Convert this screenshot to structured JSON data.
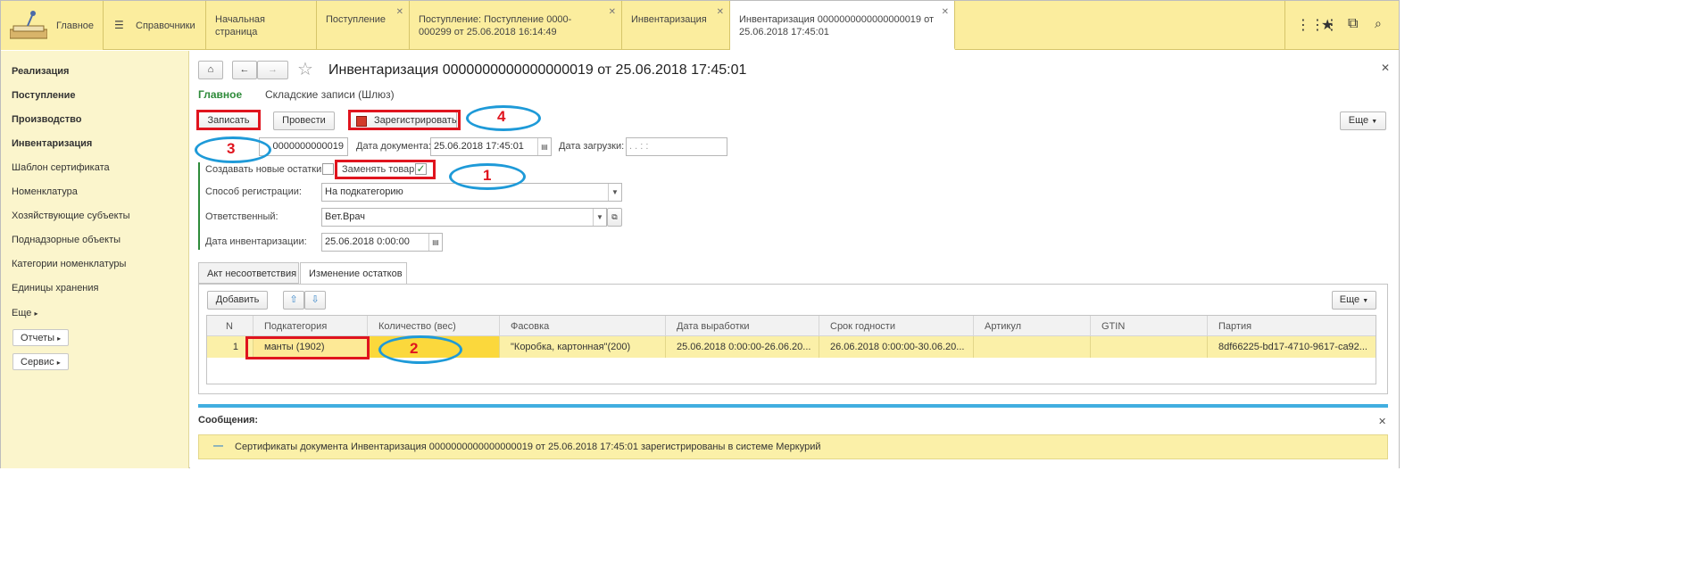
{
  "topbar": {
    "home_label": "Главное",
    "directories_label": "Справочники",
    "tabs": [
      {
        "label": "Начальная страница"
      },
      {
        "label": "Поступление"
      },
      {
        "label": "Поступление: Поступление 0000-000299 от 25.06.2018 16:14:49"
      },
      {
        "label": "Инвентаризация"
      },
      {
        "label": "Инвентаризация 0000000000000000019 от 25.06.2018 17:45:01"
      }
    ],
    "icons": [
      "apps-grid-icon",
      "star-icon",
      "history-icon",
      "search-icon"
    ]
  },
  "sidebar": {
    "items": [
      {
        "label": "Реализация"
      },
      {
        "label": "Поступление"
      },
      {
        "label": "Производство"
      },
      {
        "label": "Инвентаризация"
      },
      {
        "label": "Шаблон сертификата"
      },
      {
        "label": "Номенклатура"
      },
      {
        "label": "Хозяйствующие субъекты"
      },
      {
        "label": "Поднадзорные объекты"
      },
      {
        "label": "Категории номенклатуры"
      },
      {
        "label": "Единицы хранения"
      }
    ],
    "more_label": "Еще",
    "reports_label": "Отчеты",
    "service_label": "Сервис"
  },
  "doc": {
    "title": "Инвентаризация 0000000000000000019 от 25.06.2018 17:45:01",
    "subtabs": [
      "Главное",
      "Складские записи (Шлюз)"
    ],
    "buttons": {
      "save": "Записать",
      "post": "Провести",
      "register": "Зарегистрировать",
      "more": "Еще"
    },
    "number_value": "0000000000019",
    "doc_date_label": "Дата документа:",
    "doc_date_value": "25.06.2018 17:45:01",
    "load_date_label": "Дата загрузки:",
    "load_date_value": " .   .      :  :",
    "create_new_label": "Создавать новые остатки:",
    "replace_goods_label": "Заменять товар:",
    "reg_method_label": "Способ регистрации:",
    "reg_method_value": "На подкатегорию",
    "responsible_label": "Ответственный:",
    "responsible_value": "Вет.Врач",
    "inv_date_label": "Дата инвентаризации:",
    "inv_date_value": "25.06.2018  0:00:00"
  },
  "tabs": {
    "mismatch_label": "Акт несоответствия",
    "changes_label": "Изменение остатков"
  },
  "grid": {
    "add_label": "Добавить",
    "more_label": "Еще",
    "headers": [
      "N",
      "Подкатегория",
      "Количество (вес)",
      "Фасовка",
      "Дата выработки",
      "Срок годности",
      "Артикул",
      "GTIN",
      "Партия"
    ],
    "rows": [
      {
        "n": "1",
        "subcategory": "манты (1902)",
        "qty": "",
        "packaging": "\"Коробка, картонная\"(200)",
        "prod_date": "25.06.2018 0:00:00-26.06.20...",
        "expiry": "26.06.2018 0:00:00-30.06.20...",
        "article": "",
        "gtin": "",
        "batch": "8df66225-bd17-4710-9617-ca92..."
      }
    ]
  },
  "messages": {
    "title": "Сообщения:",
    "text": "Сертификаты документа Инвентаризация 0000000000000000019 от 25.06.2018 17:45:01 зарегистрированы в системе Меркурий"
  },
  "annotations": [
    "1",
    "2",
    "3",
    "4"
  ],
  "colors": {
    "topbar": "#fbed9e",
    "sidebar": "#fbf5cc",
    "selected_row": "#fbf0a8",
    "accent_green": "#2e8b3a",
    "annotation_red": "#e0141e",
    "annotation_blue": "#1e9ad8",
    "messages_bar": "#41aee0"
  }
}
